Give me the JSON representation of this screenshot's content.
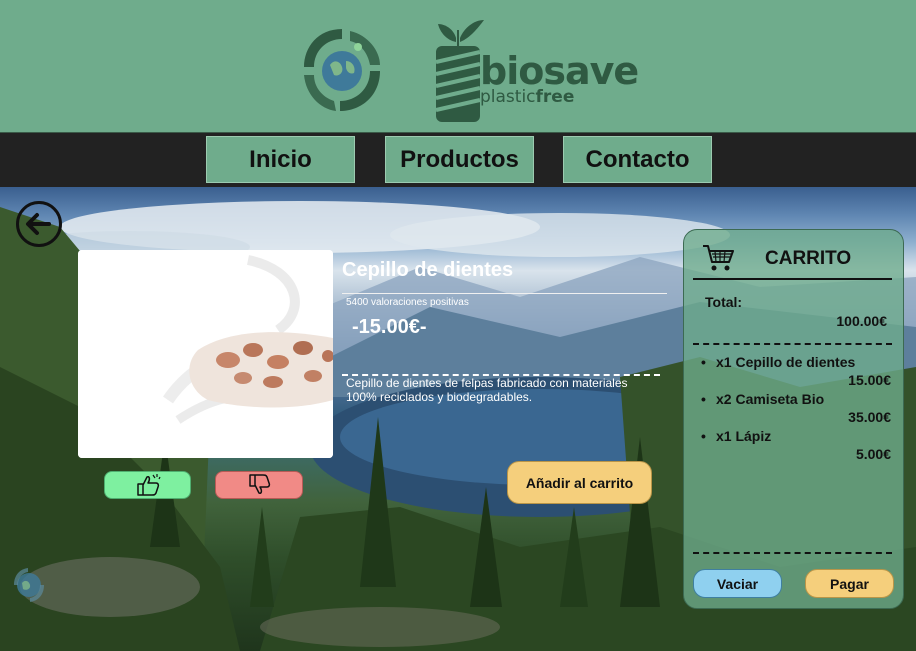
{
  "brand": {
    "name": "biosave",
    "sub_prefix": "plastic",
    "sub_suffix": "free"
  },
  "nav": {
    "items": [
      {
        "label": "Inicio"
      },
      {
        "label": "Productos"
      },
      {
        "label": "Contacto"
      }
    ]
  },
  "product": {
    "title": "Cepillo de dientes",
    "ratings": "5400 valoraciones positivas",
    "price": "-15.00€-",
    "description": "Cepillo de dientes de felpas fabricado con materiales 100% reciclados y biodegradables.",
    "add_to_cart_label": "Añadir al carrito"
  },
  "cart": {
    "title": "CARRITO",
    "total_label": "Total:",
    "total_value": "100.00€",
    "items": [
      {
        "bullet": "•",
        "name": "x1  Cepillo de dientes",
        "price": "15.00€"
      },
      {
        "bullet": "•",
        "name": "x2 Camiseta Bio",
        "price": "35.00€"
      },
      {
        "bullet": "•",
        "name": "x1 Lápiz",
        "price": "5.00€"
      }
    ],
    "empty_label": "Vaciar",
    "pay_label": "Pagar"
  },
  "icons": {
    "recycle": "recycle-globe-icon",
    "brand": "bottle-leaf-icon",
    "back": "arrow-left-icon",
    "like": "thumbs-up-icon",
    "dislike": "thumbs-down-icon",
    "cart": "shopping-cart-icon"
  },
  "colors": {
    "brand_green": "#6fac8c",
    "nav_dark": "#222222",
    "like": "#7ef0a0",
    "dislike": "#f18a86",
    "accent_yellow": "#f5cf7c",
    "empty_blue": "#8fd0ef"
  }
}
